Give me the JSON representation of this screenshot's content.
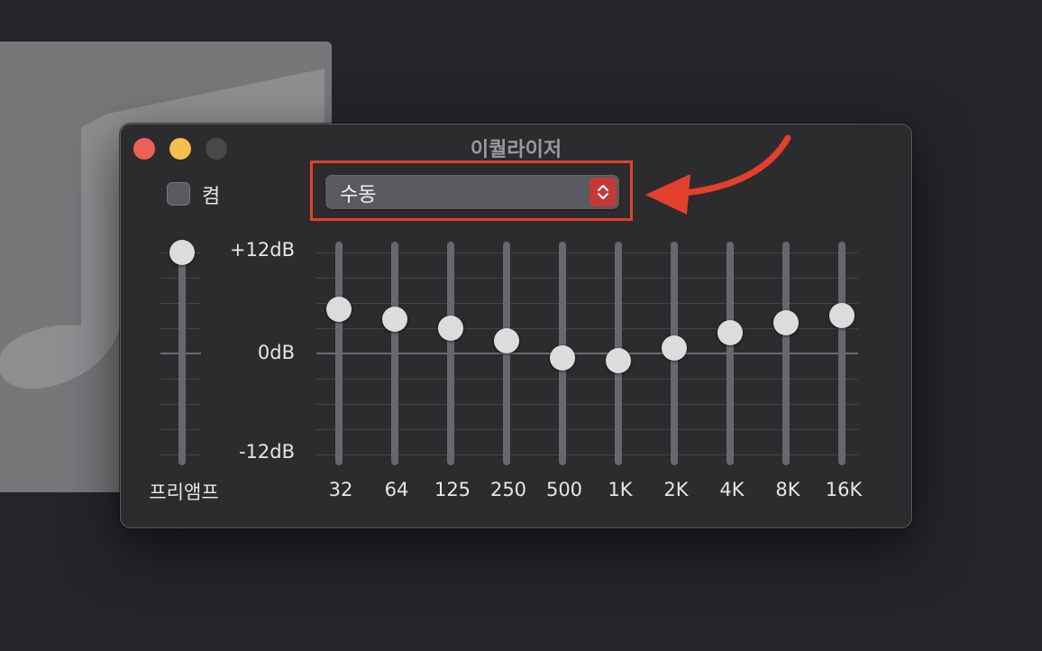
{
  "window": {
    "title": "이퀄라이저"
  },
  "toggle": {
    "label": "켬",
    "checked": false
  },
  "preset": {
    "value": "수동"
  },
  "db_labels": {
    "top": "+12dB",
    "mid": "0dB",
    "bottom": "-12dB"
  },
  "preamp": {
    "label": "프리앰프",
    "gain_db": 12
  },
  "bands": [
    {
      "label": "32",
      "gain_db": 5.3
    },
    {
      "label": "64",
      "gain_db": 4.1
    },
    {
      "label": "125",
      "gain_db": 3.0
    },
    {
      "label": "250",
      "gain_db": 1.5
    },
    {
      "label": "500",
      "gain_db": -0.5
    },
    {
      "label": "1K",
      "gain_db": -0.9
    },
    {
      "label": "2K",
      "gain_db": 0.6
    },
    {
      "label": "4K",
      "gain_db": 2.5
    },
    {
      "label": "8K",
      "gain_db": 3.6
    },
    {
      "label": "16K",
      "gain_db": 4.5
    }
  ],
  "colors": {
    "highlight": "#e3402d",
    "stepper": "#c4383a",
    "close": "#ee5f57",
    "minimize": "#f6bd4f"
  }
}
